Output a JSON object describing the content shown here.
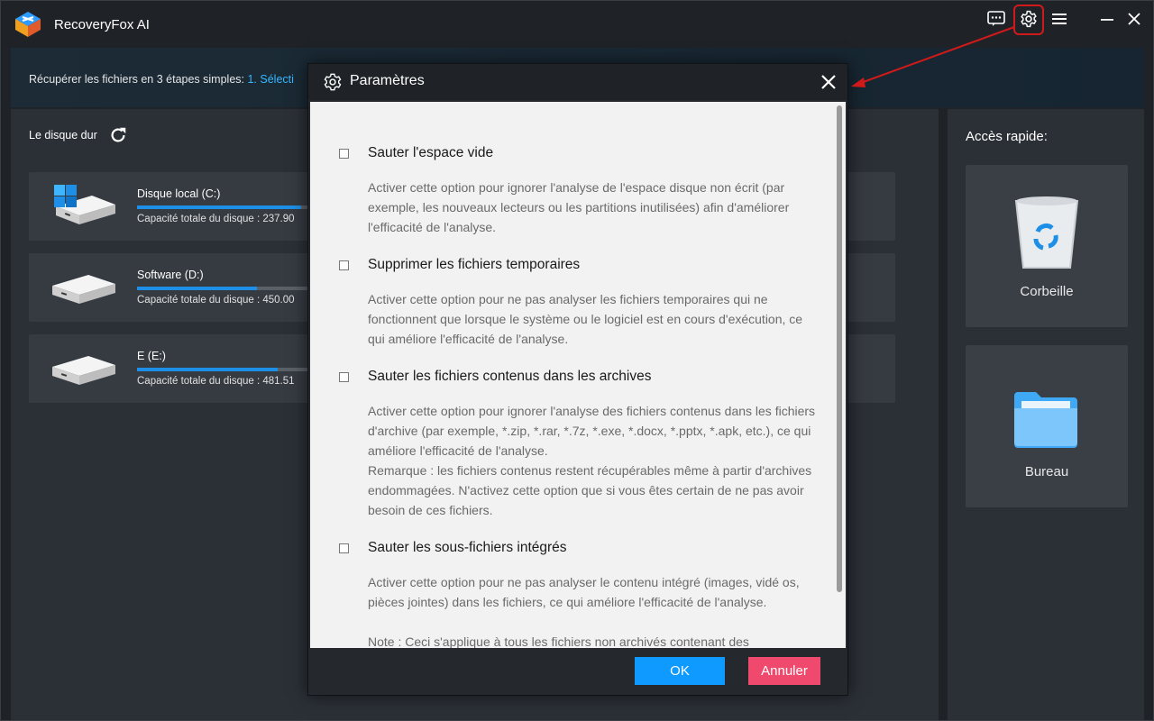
{
  "app": {
    "title": "RecoveryFox AI"
  },
  "banner": {
    "text": "Récupérer les fichiers en 3 étapes simples: ",
    "step": "1. Sélecti"
  },
  "left": {
    "section_title": "Le disque dur",
    "drives": [
      {
        "name": "Disque local (C:)",
        "capacity": "Capacité totale du disque : 237.90",
        "used_fraction": 0.96
      },
      {
        "name": "Software (D:)",
        "capacity": "Capacité totale du disque : 450.00",
        "used_fraction": 0.7
      },
      {
        "name": "E (E:)",
        "capacity": "Capacité totale du disque : 481.51",
        "used_fraction": 0.82
      }
    ]
  },
  "quick": {
    "title": "Accès rapide:",
    "items": [
      {
        "label": "Corbeille",
        "icon": "recycle-bin-icon"
      },
      {
        "label": "Bureau",
        "icon": "folder-icon"
      }
    ]
  },
  "modal": {
    "title": "Paramètres",
    "options": [
      {
        "title": "Sauter l'espace vide",
        "checked": false,
        "desc": [
          "Activer cette option pour ignorer l'analyse de l'espace disque non écrit (par exemple, les nouveaux lecteurs ou les partitions inutilisées) afin d'améliorer l'efficacité de l'analyse."
        ]
      },
      {
        "title": "Supprimer les fichiers temporaires",
        "checked": false,
        "desc": [
          "Activer cette option pour ne pas analyser les fichiers temporaires qui ne fonctionnent que lorsque le système ou le logiciel est en cours d'exécution, ce qui améliore l'efficacité de l'analyse."
        ]
      },
      {
        "title": "Sauter les fichiers contenus dans les archives",
        "checked": false,
        "desc": [
          "Activer cette option pour ignorer l'analyse des fichiers contenus dans les fichiers d'archive (par exemple, *.zip, *.rar, *.7z, *.exe, *.docx, *.pptx, *.apk, etc.), ce qui améliore l'efficacité de l'analyse.",
          "Remarque : les fichiers contenus restent récupérables même à partir d'archives endommagées. N'activez cette option que si vous êtes certain de ne pas avoir besoin de ces fichiers."
        ]
      },
      {
        "title": "Sauter les sous-fichiers intégrés",
        "checked": false,
        "desc": [
          "Activer cette option pour ne pas analyser le contenu intégré (images, vidé os, pièces jointes) dans les fichiers, ce qui améliore l'efficacité de l'analyse.",
          "Note : Ceci s'applique à tous les fichiers non archivés contenant des"
        ]
      }
    ],
    "ok_label": "OK",
    "cancel_label": "Annuler"
  },
  "colors": {
    "accent": "#0f9aff",
    "cancel": "#ef4a6e",
    "highlight": "#d01a1a",
    "step_text": "#35b7ff"
  }
}
